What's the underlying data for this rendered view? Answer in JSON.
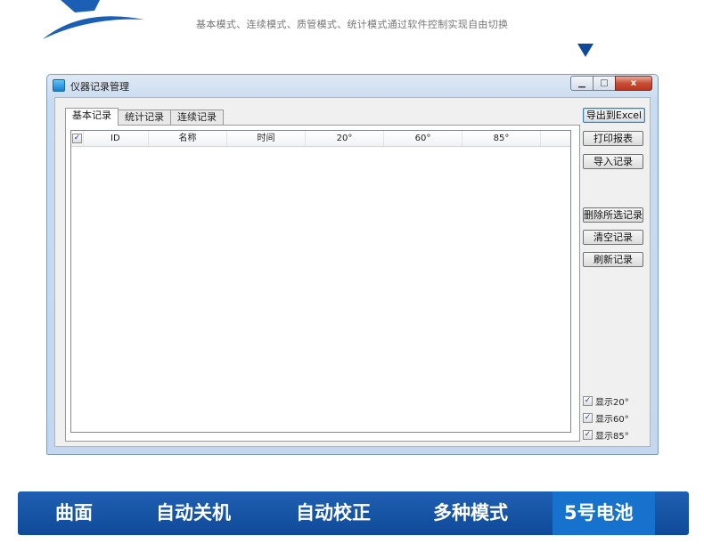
{
  "banner": {
    "subtitle": "基本模式、连续模式、质管模式、统计模式通过软件控制实现自由切换"
  },
  "window": {
    "title": "仪器记录管理",
    "min_glyph": "▁",
    "max_glyph": "□",
    "close_glyph": "x"
  },
  "tabs": [
    {
      "label": "基本记录",
      "active": true
    },
    {
      "label": "统计记录",
      "active": false
    },
    {
      "label": "连续记录",
      "active": false
    }
  ],
  "grid": {
    "select_all_checked": "✓",
    "columns": [
      "ID",
      "名称",
      "时间",
      "20°",
      "60°",
      "85°"
    ],
    "rows": []
  },
  "buttons": {
    "export": "导出到Excel",
    "print": "打印报表",
    "import": "导入记录",
    "delete": "删除所选记录",
    "clear": "清空记录",
    "refresh": "刷新记录"
  },
  "display_options": [
    {
      "label": "显示20°",
      "checked": "✓"
    },
    {
      "label": "显示60°",
      "checked": "✓"
    },
    {
      "label": "显示85°",
      "checked": "✓"
    }
  ],
  "features": [
    "曲面",
    "自动关机",
    "自动校正",
    "多种模式",
    "5号电池"
  ],
  "colors": {
    "feature_bar": "#1f5fb2",
    "feature_active": "#1672cc",
    "logo": "#1a5fb4"
  }
}
